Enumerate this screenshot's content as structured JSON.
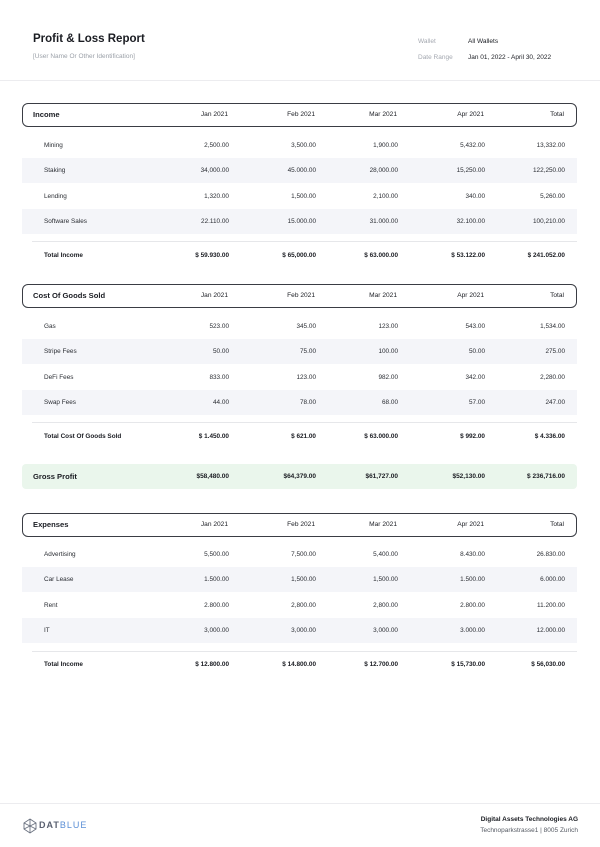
{
  "header": {
    "title": "Profit & Loss Report",
    "subtitle": "[User Name Or Other Identification]",
    "wallet_label": "Wallet",
    "wallet_value": "All Wallets",
    "date_label": "Date Range",
    "date_value": "Jan 01, 2022 - April 30, 2022"
  },
  "columns": [
    "Jan 2021",
    "Feb 2021",
    "Mar 2021",
    "Apr 2021",
    "Total"
  ],
  "income": {
    "title": "Income",
    "rows": [
      {
        "label": "Mining",
        "values": [
          "2,500.00",
          "3,500.00",
          "1,900.00",
          "5,432.00",
          "13,332.00"
        ]
      },
      {
        "label": "Staking",
        "values": [
          "34,000.00",
          "45.000.00",
          "28,000.00",
          "15,250.00",
          "122,250.00"
        ]
      },
      {
        "label": "Lending",
        "values": [
          "1,320.00",
          "1,500.00",
          "2,100.00",
          "340.00",
          "5,260.00"
        ]
      },
      {
        "label": "Software Sales",
        "values": [
          "22.110.00",
          "15.000.00",
          "31.000.00",
          "32.100.00",
          "100,210.00"
        ]
      }
    ],
    "total": {
      "label": "Total Income",
      "values": [
        "$ 59.930.00",
        "$ 65,000.00",
        "$ 63.000.00",
        "$ 53.122.00",
        "$ 241.052.00"
      ]
    }
  },
  "cogs": {
    "title": "Cost Of Goods Sold",
    "rows": [
      {
        "label": "Gas",
        "values": [
          "523.00",
          "345.00",
          "123.00",
          "543.00",
          "1,534.00"
        ]
      },
      {
        "label": "Stripe Fees",
        "values": [
          "50.00",
          "75.00",
          "100.00",
          "50.00",
          "275.00"
        ]
      },
      {
        "label": "DeFi Fees",
        "values": [
          "833.00",
          "123.00",
          "982.00",
          "342.00",
          "2,280.00"
        ]
      },
      {
        "label": "Swap Fees",
        "values": [
          "44.00",
          "78.00",
          "68.00",
          "57.00",
          "247.00"
        ]
      }
    ],
    "total": {
      "label": "Total Cost Of Goods Sold",
      "values": [
        "$ 1.450.00",
        "$ 621.00",
        "$ 63.000.00",
        "$ 992.00",
        "$ 4.336.00"
      ]
    }
  },
  "gross": {
    "label": "Gross Profit",
    "values": [
      "$58,480.00",
      "$64,379.00",
      "$61,727.00",
      "$52,130.00",
      "$ 236,716.00"
    ]
  },
  "expenses": {
    "title": "Expenses",
    "rows": [
      {
        "label": "Advertising",
        "values": [
          "5,500.00",
          "7,500.00",
          "5,400.00",
          "8.430.00",
          "26.830.00"
        ]
      },
      {
        "label": "Car Lease",
        "values": [
          "1.500.00",
          "1,500.00",
          "1,500.00",
          "1.500.00",
          "6.000.00"
        ]
      },
      {
        "label": "Rent",
        "values": [
          "2.800.00",
          "2,800.00",
          "2,800.00",
          "2.800.00",
          "11.200.00"
        ]
      },
      {
        "label": "IT",
        "values": [
          "3,000.00",
          "3,000.00",
          "3,000.00",
          "3.000.00",
          "12.000.00"
        ]
      }
    ],
    "total": {
      "label": "Total Income",
      "values": [
        "$ 12.800.00",
        "$ 14.800.00",
        "$ 12.700.00",
        "$ 15,730.00",
        "$ 56,030.00"
      ]
    }
  },
  "footer": {
    "logo_left": "DAT",
    "logo_right": "BLUE",
    "company": "Digital Assets Technologies AG",
    "address": "Technoparkstrasse1 | 8005 Zurich"
  }
}
